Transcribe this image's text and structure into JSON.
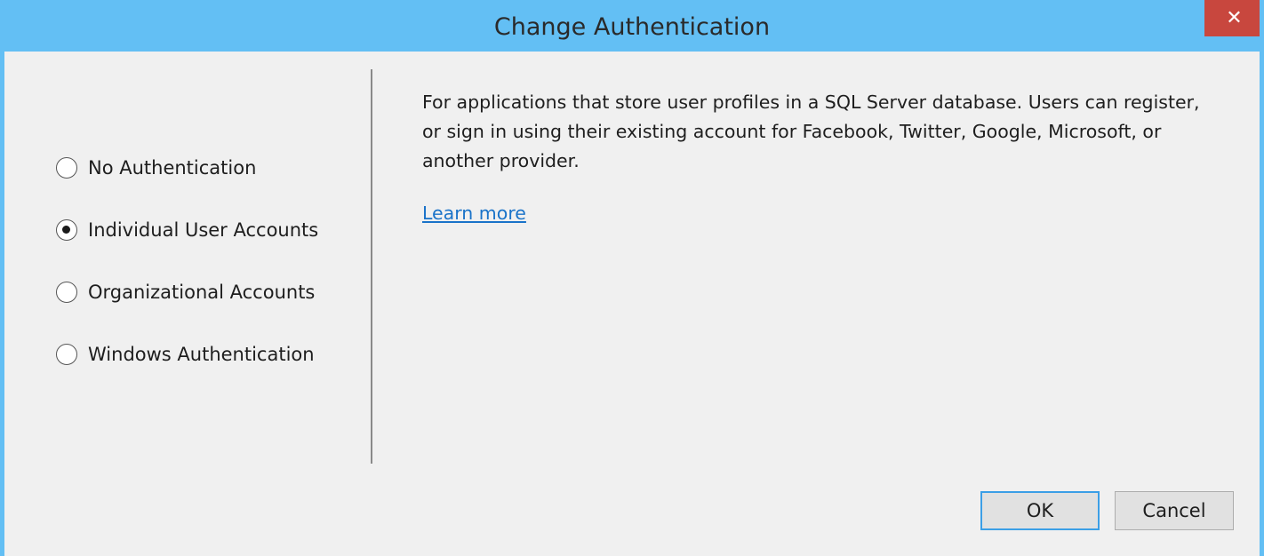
{
  "window": {
    "title": "Change Authentication",
    "close_glyph": "✕",
    "titlebar_color": "#63bff4",
    "close_color": "#c8473e"
  },
  "auth_options": [
    {
      "label": "No Authentication",
      "selected": false
    },
    {
      "label": "Individual User Accounts",
      "selected": true
    },
    {
      "label": "Organizational Accounts",
      "selected": false
    },
    {
      "label": "Windows Authentication",
      "selected": false
    }
  ],
  "details": {
    "description": "For applications that store user profiles in a SQL Server database. Users can register, or sign in using their existing account for Facebook, Twitter, Google, Microsoft, or another provider.",
    "learn_more": "Learn more",
    "link_color": "#1a73c9"
  },
  "buttons": {
    "ok": "OK",
    "cancel": "Cancel"
  }
}
